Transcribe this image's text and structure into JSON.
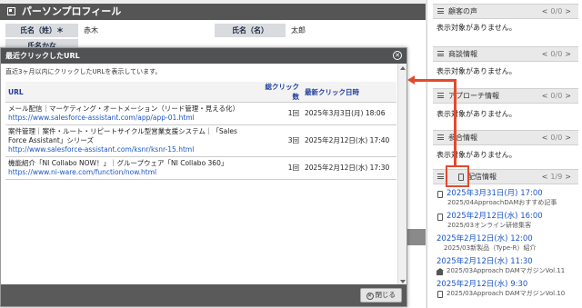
{
  "profile": {
    "title": "パーソンプロフィール",
    "last_name_label": "氏名（姓）＊",
    "last_name_value": "赤木",
    "first_name_label": "氏名（名）",
    "first_name_value": "太郎",
    "kana_label": "氏名かな"
  },
  "modal": {
    "title": "最近クリックしたURL",
    "description": "直近3ヶ月以内にクリックしたURLを表示しています。",
    "columns": {
      "url": "URL",
      "count": "総クリック数",
      "last": "最新クリック日時"
    },
    "rows": [
      {
        "title": "メール配信｜マーケティング・オートメーション（リード管理・見える化）",
        "url": "https://www.salesforce-assistant.com/app/app-01.html",
        "count": "1回",
        "last": "2025年3月3日(月) 18:06"
      },
      {
        "title": "案件管理｜案件・ルート・リピートサイクル型営業支援システム｜「Sales Force Assistant」シリーズ",
        "url": "http://www.salesforce-assistant.com/ksnr/ksnr-15.html",
        "count": "3回",
        "last": "2025年2月12日(水) 17:40"
      },
      {
        "title": "機能紹介「NI Collabo NOW！」｜グループウェア「NI Collabo 360」",
        "url": "https://www.ni-ware.com/function/now.html",
        "count": "1回",
        "last": "2025年2月12日(水) 17:30"
      }
    ],
    "close_label": "閉じる"
  },
  "panels": [
    {
      "title": "顧客の声",
      "page": "0/0",
      "empty": "表示対象がありません。"
    },
    {
      "title": "商談情報",
      "page": "0/0",
      "empty": "表示対象がありません。"
    },
    {
      "title": "アプローチ情報",
      "page": "0/0",
      "empty": "表示対象がありません。"
    },
    {
      "title": "参合情報",
      "page": "0/0",
      "empty": "表示対象がありません。"
    }
  ],
  "delivery": {
    "title": "配信情報",
    "page": "1/9",
    "items": [
      {
        "date": "2025年3月31日(月) 17:00",
        "sub": "2025/04ApproachDAMおすすめ記事",
        "icon": "pointer-icon"
      },
      {
        "date": "2025年2月12日(水) 16:00",
        "sub": "2025/03オンライン研修集客",
        "icon": "pointer-icon"
      },
      {
        "date": "2025年2月12日(水) 12:00",
        "sub": "2025/03新製品（Type-R）紹介",
        "icon": ""
      },
      {
        "date": "2025年2月12日(水) 11:30",
        "sub": "2025/03Approach DAMマガジンVol.11",
        "icon": "building-icon"
      },
      {
        "date": "2025年2月12日(水) 9:30",
        "sub": "2025/03Approach DAMマガジンVol.10",
        "icon": "pointer-icon"
      }
    ]
  },
  "colors": {
    "accent": "#1a56c7",
    "annotation": "#e24a2e",
    "header_dark": "#505254"
  }
}
